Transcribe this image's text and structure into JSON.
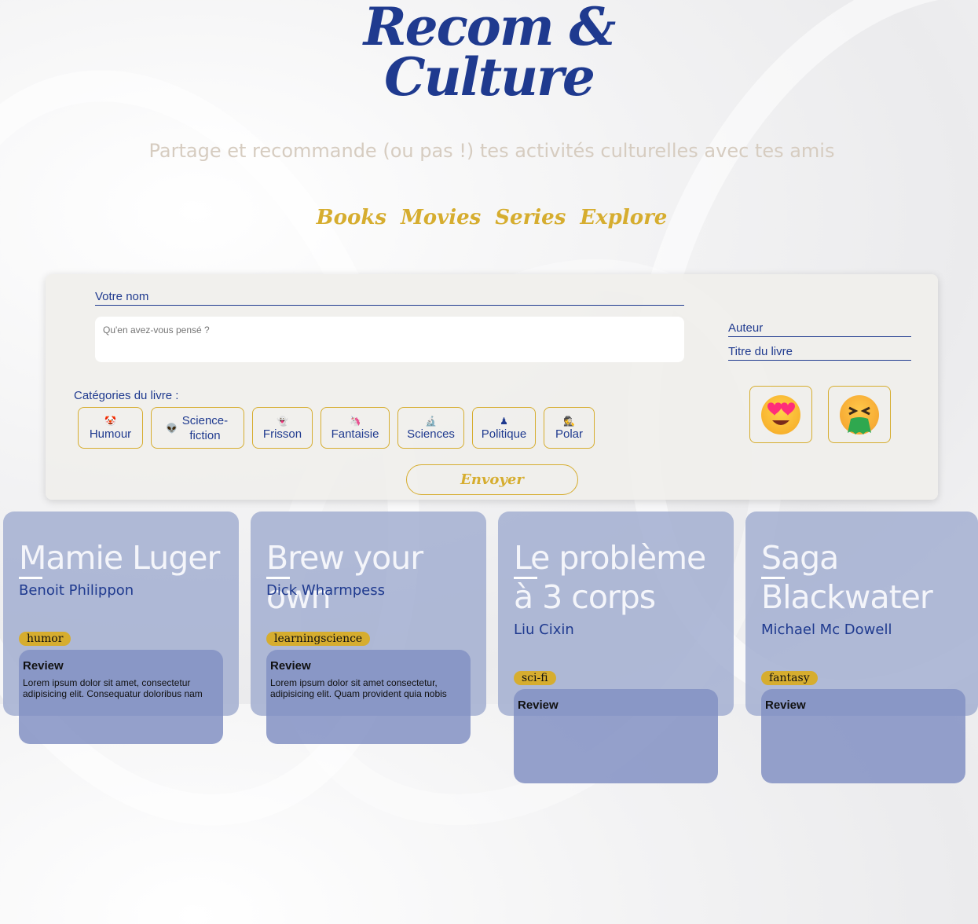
{
  "header": {
    "logo_line1": "Recom &",
    "logo_line2": "Culture",
    "tagline": "Partage et recommande (ou pas !) tes activités culturelles avec tes amis"
  },
  "nav": {
    "items": [
      {
        "label": "Books"
      },
      {
        "label": "Movies"
      },
      {
        "label": "Series"
      },
      {
        "label": "Explore"
      }
    ]
  },
  "form": {
    "name_placeholder": "Votre nom",
    "review_placeholder": "Qu'en avez-vous pensé ?",
    "author_placeholder": "Auteur",
    "title_placeholder": "Titre du livre",
    "categories_label": "Catégories du livre :",
    "categories": [
      {
        "icon": "🤡",
        "label": "Humour"
      },
      {
        "icon": "👽",
        "label": "Science-fiction"
      },
      {
        "icon": "👻",
        "label": "Frisson"
      },
      {
        "icon": "🦄",
        "label": "Fantaisie"
      },
      {
        "icon": "🔬",
        "label": "Sciences"
      },
      {
        "icon": "♟",
        "label": "Politique"
      },
      {
        "icon": "🕵",
        "label": "Polar"
      }
    ],
    "reactions": [
      {
        "icon": "heart-eyes-face-icon"
      },
      {
        "icon": "vomiting-face-icon"
      }
    ],
    "submit_label": "Envoyer"
  },
  "cards": [
    {
      "title": "Mamie Luger",
      "author": "Benoit Philippon",
      "tag": "humor",
      "review_title": "Review",
      "review_text": "Lorem ipsum dolor sit amet, consectetur adipisicing elit. Consequatur doloribus nam"
    },
    {
      "title": "Brew your own",
      "author": "Dick Wharmpess",
      "tag": "learningscience",
      "review_title": "Review",
      "review_text": "Lorem ipsum dolor sit amet consectetur, adipisicing elit. Quam provident quia nobis"
    },
    {
      "title": "Le problème à 3 corps",
      "author": "Liu Cixin",
      "tag": "sci-fi",
      "review_title": "Review",
      "review_text": ""
    },
    {
      "title": "Saga Blackwater",
      "author": "Michael Mc Dowell",
      "tag": "fantasy",
      "review_title": "Review",
      "review_text": ""
    }
  ],
  "colors": {
    "brand_blue": "#1f3a8f",
    "gold": "#d6ad2f",
    "card_bg": "#a5b0d2"
  }
}
